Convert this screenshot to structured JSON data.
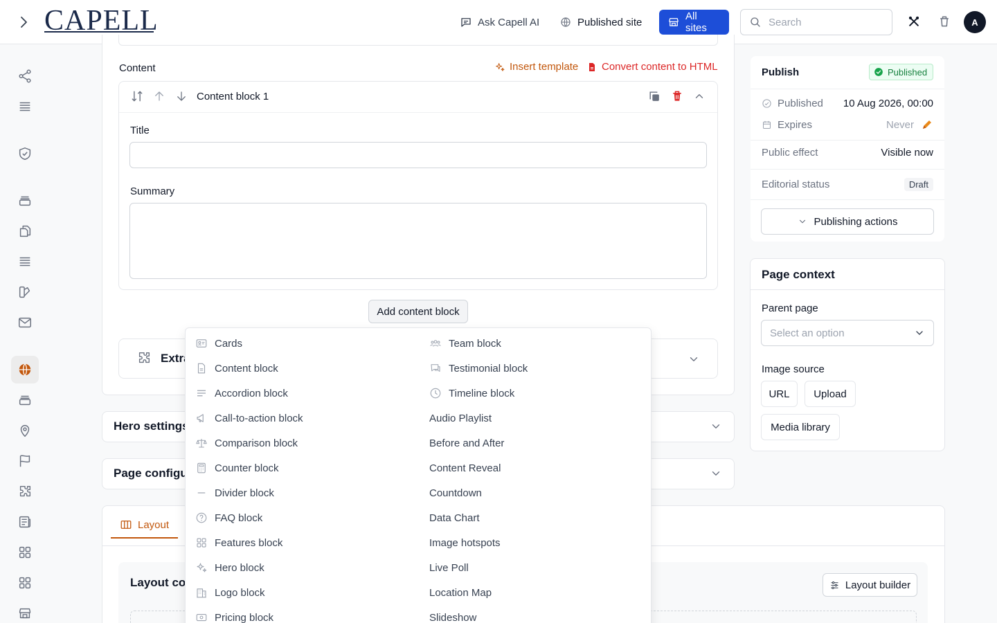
{
  "topbar": {
    "logo_text": "CAPELL",
    "ask_ai": "Ask Capell AI",
    "published_site": "Published site",
    "all_sites": "All sites",
    "search_placeholder": "Search",
    "avatar_initial": "A"
  },
  "content": {
    "label": "Content",
    "insert_template": "Insert template",
    "convert_html": "Convert content to HTML",
    "block_title": "Content block 1",
    "title_label": "Title",
    "summary_label": "Summary",
    "add_block": "Add content block",
    "extra_label": "Extra"
  },
  "sections": {
    "hero": "Hero settings",
    "page_config": "Page configur",
    "layout_tab": "Layout",
    "layout_content": "Layout co",
    "layout_builder": "Layout builder"
  },
  "block_menu": {
    "left": [
      {
        "label": "Cards",
        "icon": "cards-icon"
      },
      {
        "label": "Content block",
        "icon": "document-icon"
      },
      {
        "label": "Accordion block",
        "icon": "lines-icon"
      },
      {
        "label": "Call-to-action block",
        "icon": "megaphone-icon"
      },
      {
        "label": "Comparison block",
        "icon": "scale-icon"
      },
      {
        "label": "Counter block",
        "icon": "calculator-icon"
      },
      {
        "label": "Divider block",
        "icon": "divider-icon"
      },
      {
        "label": "FAQ block",
        "icon": "question-icon"
      },
      {
        "label": "Features block",
        "icon": "grid-icon"
      },
      {
        "label": "Hero block",
        "icon": "sparkles-icon"
      },
      {
        "label": "Logo block",
        "icon": "building-icon"
      },
      {
        "label": "Pricing block",
        "icon": "pricing-icon"
      }
    ],
    "right": [
      {
        "label": "Team block",
        "icon": "team-icon"
      },
      {
        "label": "Testimonial block",
        "icon": "chat-icon"
      },
      {
        "label": "Timeline block",
        "icon": "clock-icon"
      },
      {
        "label": "Audio Playlist",
        "icon": ""
      },
      {
        "label": "Before and After",
        "icon": ""
      },
      {
        "label": "Content Reveal",
        "icon": ""
      },
      {
        "label": "Countdown",
        "icon": ""
      },
      {
        "label": "Data Chart",
        "icon": ""
      },
      {
        "label": "Image hotspots",
        "icon": ""
      },
      {
        "label": "Live Poll",
        "icon": ""
      },
      {
        "label": "Location Map",
        "icon": ""
      },
      {
        "label": "Slideshow",
        "icon": ""
      }
    ]
  },
  "publish": {
    "title": "Publish",
    "status_badge": "Published",
    "published_label": "Published",
    "published_value": "10 Aug 2026, 00:00",
    "expires_label": "Expires",
    "expires_value": "Never",
    "public_effect_label": "Public effect",
    "public_effect_value": "Visible now",
    "editorial_label": "Editorial status",
    "editorial_value": "Draft",
    "actions": "Publishing actions"
  },
  "page_context": {
    "title": "Page context",
    "parent_label": "Parent page",
    "parent_placeholder": "Select an option",
    "image_source_label": "Image source",
    "url_btn": "URL",
    "upload_btn": "Upload",
    "media_btn": "Media library"
  },
  "colors": {
    "accent_orange": "#c2570c",
    "danger_red": "#dc2626",
    "primary_blue": "#1d4ed8",
    "success_green": "#15803d"
  }
}
